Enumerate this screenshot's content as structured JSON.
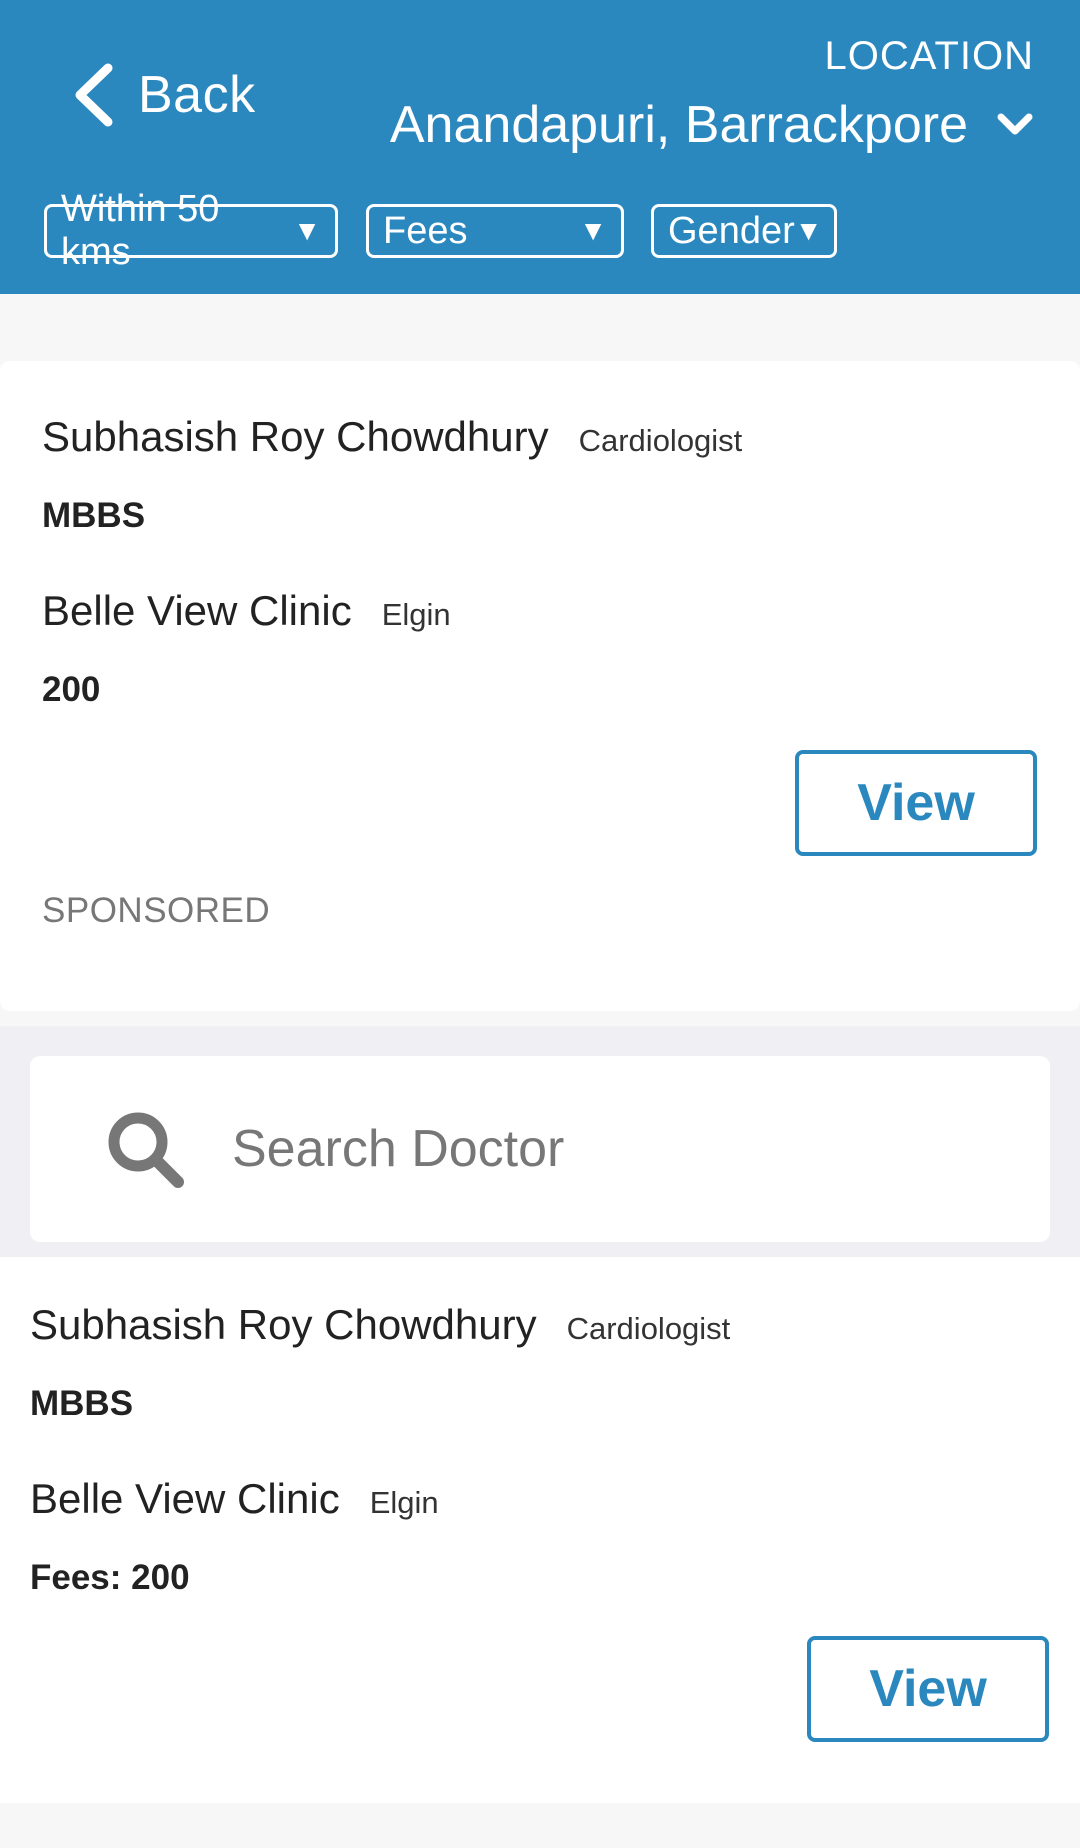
{
  "header": {
    "back_label": "Back",
    "location_caption": "LOCATION",
    "location_value": "Anandapuri, Barrackpore",
    "filters": [
      {
        "label": "Within 50 kms",
        "caret": "▼"
      },
      {
        "label": "Fees",
        "caret": "▼"
      },
      {
        "label": "Gender",
        "caret": "▼"
      }
    ],
    "accent_color": "#2a88bf"
  },
  "sponsored_card": {
    "doctor_name": "Subhasish Roy Chowdhury",
    "specialty": "Cardiologist",
    "degree": "MBBS",
    "clinic": "Belle View Clinic",
    "area": "Elgin",
    "fees": "200",
    "view_label": "View",
    "badge": "SPONSORED"
  },
  "search": {
    "placeholder": "Search Doctor",
    "icon": "search-icon"
  },
  "doctor_card": {
    "doctor_name": "Subhasish Roy Chowdhury",
    "specialty": "Cardiologist",
    "degree": "MBBS",
    "clinic": "Belle View Clinic",
    "area": "Elgin",
    "fees": "Fees: 200",
    "view_label": "View"
  }
}
